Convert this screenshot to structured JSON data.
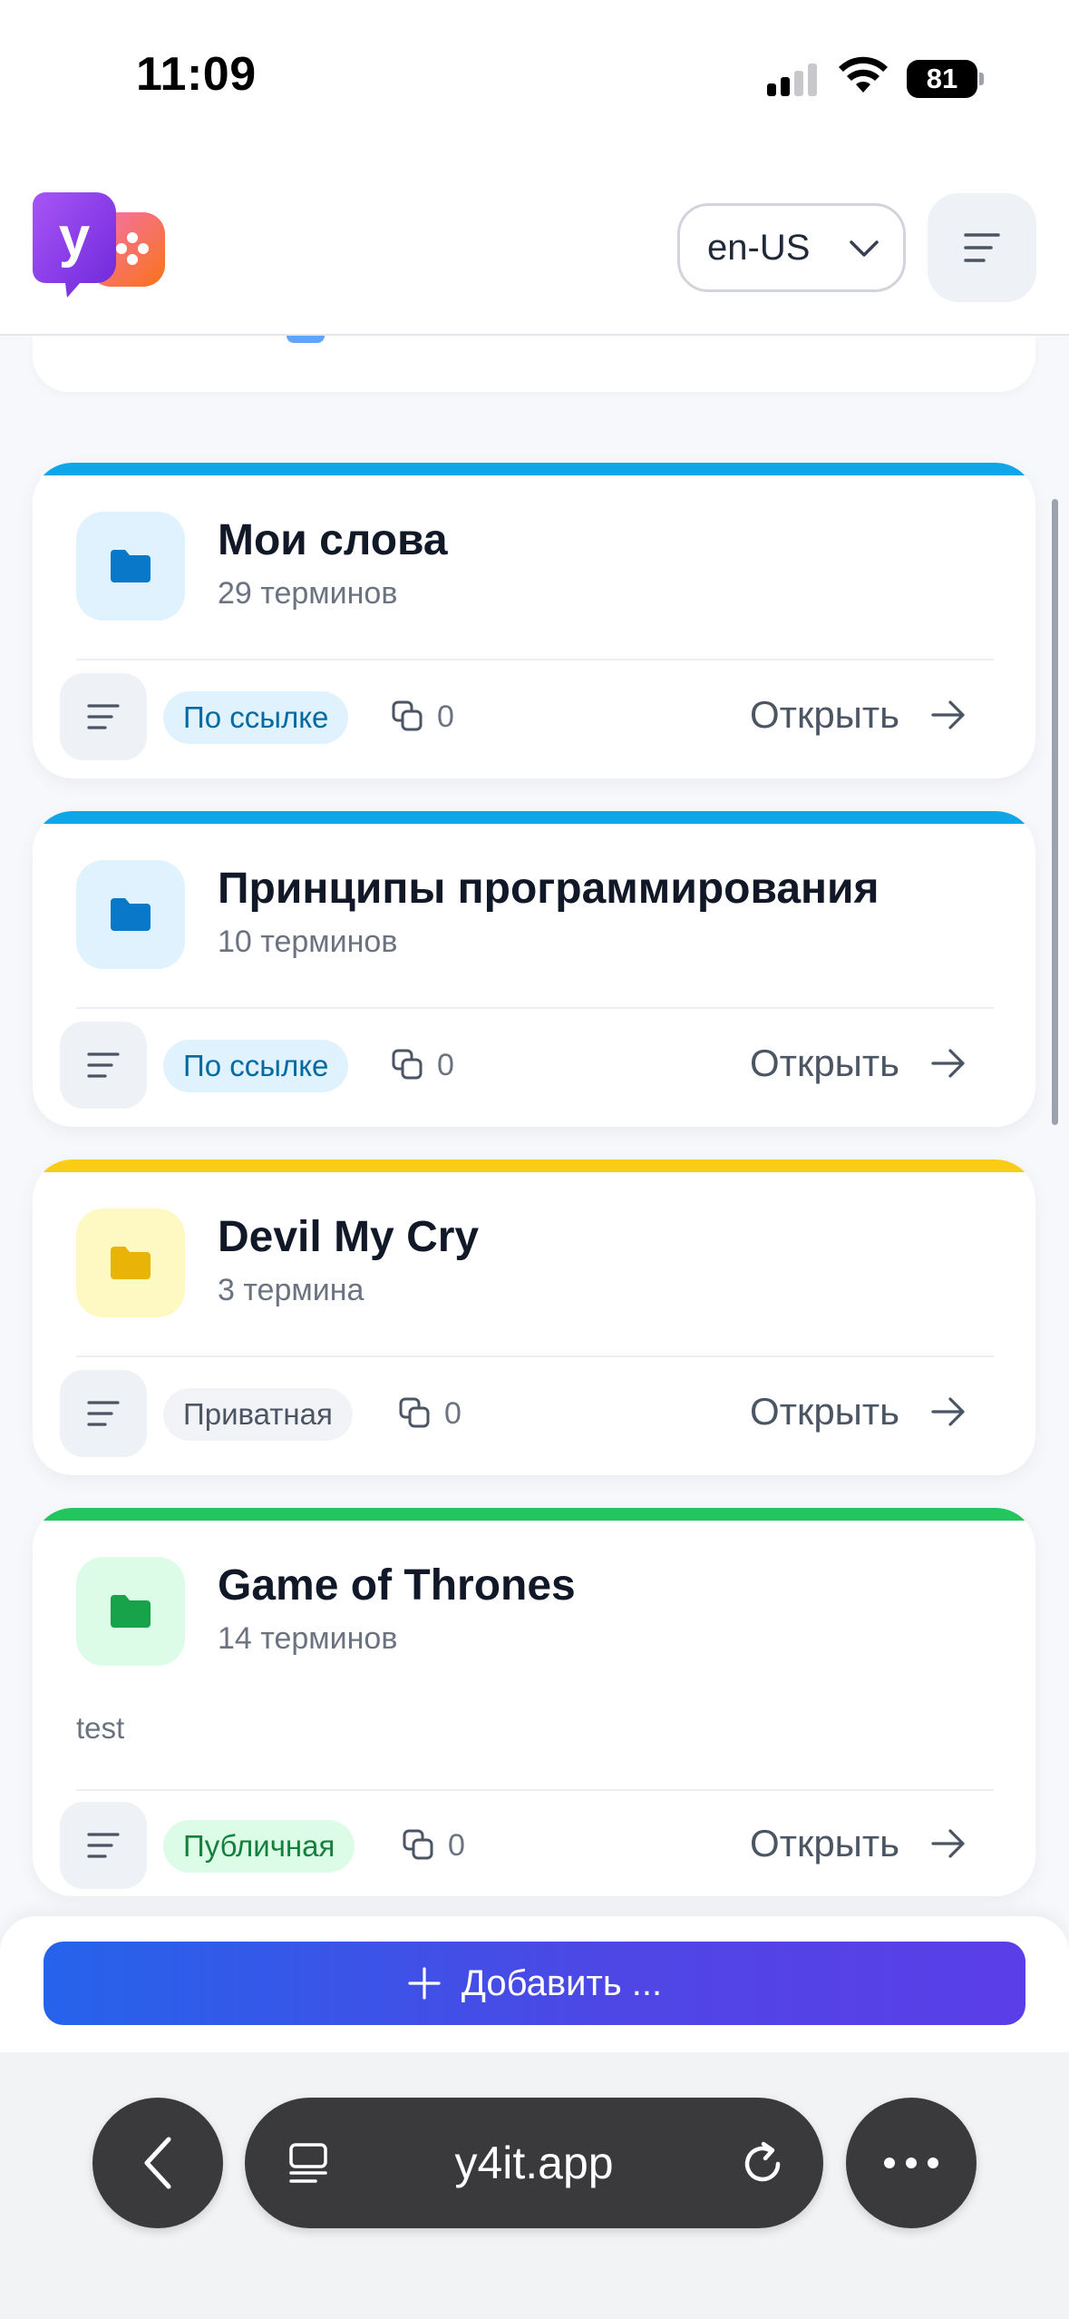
{
  "status_bar": {
    "time": "11:09",
    "battery": "81"
  },
  "header": {
    "logo_letter": "y",
    "language": "en-US"
  },
  "collections": [
    {
      "title": "Мои слова",
      "terms": "29 терминов",
      "description": "",
      "visibility": "По ссылке",
      "visibility_type": "link",
      "accent": "#0ea5e9",
      "folder_color": "#0a78c9",
      "folder_bg": "#e0f2fe",
      "copies": "0",
      "open_label": "Открыть"
    },
    {
      "title": "Принципы программирования",
      "terms": "10 терминов",
      "description": "",
      "visibility": "По ссылке",
      "visibility_type": "link",
      "accent": "#0ea5e9",
      "folder_color": "#0a78c9",
      "folder_bg": "#e0f2fe",
      "copies": "0",
      "open_label": "Открыть"
    },
    {
      "title": "Devil My Cry",
      "terms": "3 термина",
      "description": "",
      "visibility": "Приватная",
      "visibility_type": "private",
      "accent": "#facc15",
      "folder_color": "#eab308",
      "folder_bg": "#fef9c3",
      "copies": "0",
      "open_label": "Открыть"
    },
    {
      "title": "Game of Thrones",
      "terms": "14 терминов",
      "description": "test",
      "visibility": "Публичная",
      "visibility_type": "public",
      "accent": "#22c55e",
      "folder_color": "#16a34a",
      "folder_bg": "#dcfce7",
      "copies": "0",
      "open_label": "Открыть"
    }
  ],
  "add_button": {
    "label": "Добавить ..."
  },
  "browser": {
    "url": "y4it.app"
  }
}
